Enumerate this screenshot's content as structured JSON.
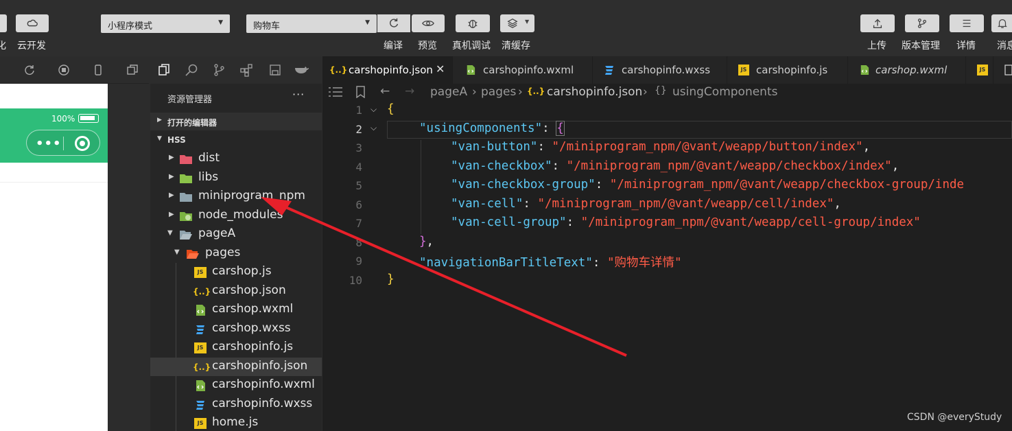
{
  "toolbar": {
    "left_label_partial": "化",
    "cloud_label": "云开发",
    "mode_select": "小程序模式",
    "page_select": "购物车",
    "compile_label": "编译",
    "preview_label": "预览",
    "debug_label": "真机调试",
    "clear_label": "清缓存",
    "upload_label": "上传",
    "version_label": "版本管理",
    "details_label": "详情",
    "messages_label": "消息"
  },
  "simulator": {
    "battery_text": "100%"
  },
  "explorer": {
    "title": "资源管理器",
    "more": "···",
    "open_editors": "打开的编辑器",
    "project": "HSS",
    "tree": [
      {
        "name": "dist",
        "icon": "folder-red-icon"
      },
      {
        "name": "libs",
        "icon": "folder-green-icon"
      },
      {
        "name": "miniprogram_npm",
        "icon": "folder-icon"
      },
      {
        "name": "node_modules",
        "icon": "folder-node-icon"
      },
      {
        "name": "pageA",
        "icon": "folder-open-icon"
      },
      {
        "name": "pages",
        "icon": "folder-pages-icon"
      },
      {
        "name": "carshop.js",
        "icon": "js-icon"
      },
      {
        "name": "carshop.json",
        "icon": "json-icon"
      },
      {
        "name": "carshop.wxml",
        "icon": "wxml-icon"
      },
      {
        "name": "carshop.wxss",
        "icon": "wxss-icon"
      },
      {
        "name": "carshopinfo.js",
        "icon": "js-icon"
      },
      {
        "name": "carshopinfo.json",
        "icon": "json-icon"
      },
      {
        "name": "carshopinfo.wxml",
        "icon": "wxml-icon"
      },
      {
        "name": "carshopinfo.wxss",
        "icon": "wxss-icon"
      },
      {
        "name": "home.js",
        "icon": "js-icon"
      }
    ]
  },
  "tabs": [
    {
      "label": "carshopinfo.json",
      "active": true
    },
    {
      "label": "carshopinfo.wxml"
    },
    {
      "label": "carshopinfo.wxss"
    },
    {
      "label": "carshopinfo.js"
    },
    {
      "label": "carshop.wxml"
    }
  ],
  "breadcrumb": {
    "part1": "pageA",
    "part2": "pages",
    "part3": "carshopinfo.json",
    "part4": "usingComponents"
  },
  "code": {
    "line_numbers": [
      "1",
      "2",
      "3",
      "4",
      "5",
      "6",
      "7",
      "8",
      "9",
      "10"
    ],
    "open_brace": "{",
    "using_key": "\"usingComponents\"",
    "colon": ": ",
    "inner_open": "{",
    "entries": [
      {
        "key": "\"van-button\"",
        "value": "\"/miniprogram_npm/@vant/weapp/button/index\"",
        "comma": ","
      },
      {
        "key": "\"van-checkbox\"",
        "value": "\"/miniprogram_npm/@vant/weapp/checkbox/index\"",
        "comma": ","
      },
      {
        "key": "\"van-checkbox-group\"",
        "value": "\"/miniprogram_npm/@vant/weapp/checkbox-group/inde",
        "comma": ""
      },
      {
        "key": "\"van-cell\"",
        "value": "\"/miniprogram_npm/@vant/weapp/cell/index\"",
        "comma": ","
      },
      {
        "key": "\"van-cell-group\"",
        "value": "\"/miniprogram_npm/@vant/weapp/cell-group/index\"",
        "comma": ""
      }
    ],
    "inner_close": "}",
    "inner_close_comma": ",",
    "nav_key": "\"navigationBarTitleText\"",
    "nav_value": "\"购物车详情\"",
    "close_brace": "}"
  },
  "watermark": "CSDN @everyStudy",
  "colors": {
    "key": "#5cc7f3",
    "string": "#ff5c47",
    "brace": "#f5d142",
    "inner_brace": "#d16ed8",
    "sim_header": "#2ebd7a",
    "annotation_arrow": "#e8202a"
  }
}
